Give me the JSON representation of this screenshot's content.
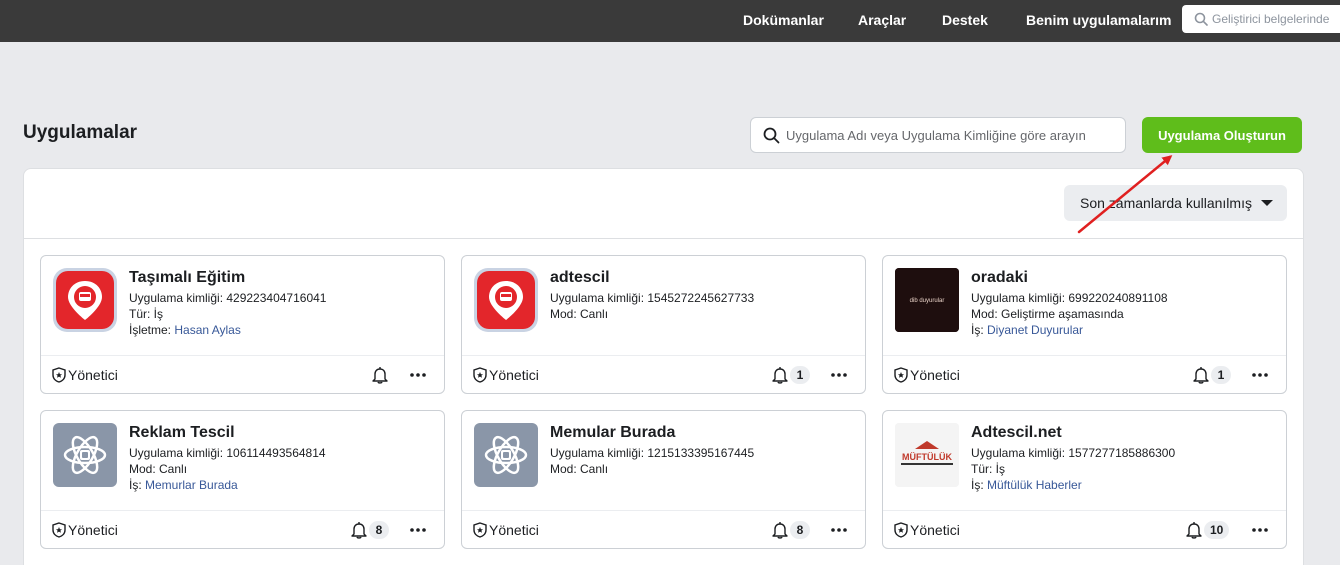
{
  "topnav": {
    "items": [
      "Dokümanlar",
      "Araçlar",
      "Destek",
      "Benim uygulamalarım"
    ],
    "search_placeholder": "Geliştirici belgelerinde"
  },
  "page": {
    "title": "Uygulamalar",
    "search_placeholder": "Uygulama Adı veya Uygulama Kimliğine göre arayın",
    "create_label": "Uygulama Oluşturun",
    "sort_label": "Son zamanlarda kullanılmış"
  },
  "apps": [
    {
      "name": "Taşımalı Eğitim",
      "id_line": "Uygulama kimliği: 429223404716041",
      "line2": "Tür: İş",
      "line3_prefix": "İşletme: ",
      "line3_link": "Hasan Aylas",
      "role": "Yönetici",
      "notif": "",
      "logo": "red-location-pin-icon"
    },
    {
      "name": "adtescil",
      "id_line": "Uygulama kimliği: 1545272245627733",
      "line2": "Mod: Canlı",
      "line3_prefix": "",
      "line3_link": "",
      "role": "Yönetici",
      "notif": "1",
      "logo": "red-location-pin-icon"
    },
    {
      "name": "oradaki",
      "id_line": "Uygulama kimliği: 699220240891108",
      "line2": "Mod: Geliştirme aşamasında",
      "line3_prefix": "İş: ",
      "line3_link": "Diyanet Duyurular",
      "role": "Yönetici",
      "notif": "1",
      "logo": "dark-brand-logo",
      "logo_text": "dib duyurular"
    },
    {
      "name": "Reklam Tescil",
      "id_line": "Uygulama kimliği: 106114493564814",
      "line2": "Mod: Canlı",
      "line3_prefix": "İş: ",
      "line3_link": "Memurlar Burada",
      "role": "Yönetici",
      "notif": "8",
      "logo": "atom-default-app-icon"
    },
    {
      "name": "Memular Burada",
      "id_line": "Uygulama kimliği: 1215133395167445",
      "line2": "Mod: Canlı",
      "line3_prefix": "",
      "line3_link": "",
      "role": "Yönetici",
      "notif": "8",
      "logo": "atom-default-app-icon"
    },
    {
      "name": "Adtescil.net",
      "id_line": "Uygulama kimliği: 1577277185886300",
      "line2": "Tür: İş",
      "line3_prefix": "İş: ",
      "line3_link": "Müftülük Haberler",
      "role": "Yönetici",
      "notif": "10",
      "logo": "muftuluk-brand-logo",
      "logo_text": "MÜFTÜLÜK"
    }
  ],
  "colors": {
    "topbar": "#3a3a3a",
    "create_button": "#5fbd1b",
    "link": "#385898",
    "annotation_arrow": "#e02020"
  }
}
